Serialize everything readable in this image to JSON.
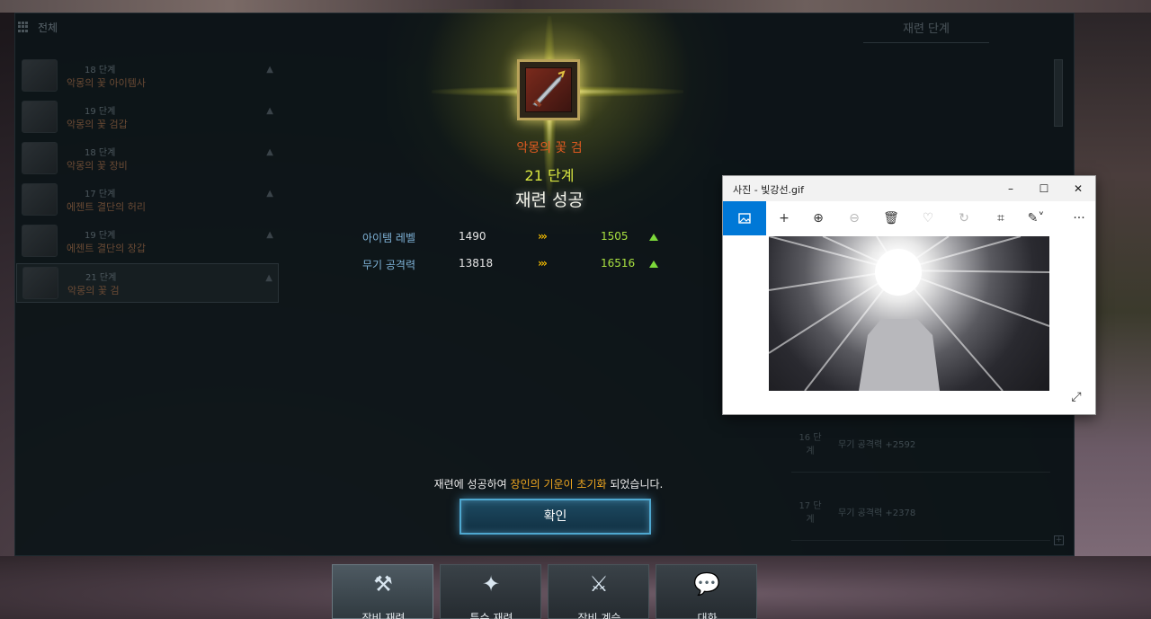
{
  "left_list": {
    "header": "전체",
    "items": [
      {
        "stage": "18 단계",
        "name": "악몽의 꽃 아이템사"
      },
      {
        "stage": "19 단계",
        "name": "악몽의 꽃 검갑"
      },
      {
        "stage": "18 단계",
        "name": "악몽의 꽃 장비"
      },
      {
        "stage": "17 단계",
        "name": "에젠트 결단의 허리"
      },
      {
        "stage": "19 단계",
        "name": "에젠트 결단의 장갑"
      },
      {
        "stage": "21 단계",
        "name": "악몽의 꽃 검"
      }
    ]
  },
  "right_panel": {
    "title": "재련 단계",
    "rows": [
      {
        "lvl": "16 단계",
        "text": "무기 공격력 +2592"
      },
      {
        "lvl": "17 단계",
        "text": "무기 공격력 +2378"
      }
    ]
  },
  "result": {
    "item_name": "악몽의 꽃 검",
    "stage": "21 단계",
    "outcome": "재련 성공",
    "stats": [
      {
        "label": "아이템 레벨",
        "before": "1490",
        "arrows": "›››",
        "after": "1505"
      },
      {
        "label": "무기 공격력",
        "before": "13818",
        "arrows": "›››",
        "after": "16516"
      }
    ],
    "message_pre": "재련에 성공하여 ",
    "message_highlight": "장인의 기운이 초기화",
    "message_post": " 되었습니다.",
    "confirm_label": "확인"
  },
  "bottom_tabs": [
    {
      "label": "장비 재련",
      "icon": "hammer-icon"
    },
    {
      "label": "특수 재련",
      "icon": "special-refine-icon"
    },
    {
      "label": "장비 계승",
      "icon": "swords-icon"
    },
    {
      "label": "대화",
      "icon": "chat-icon"
    }
  ],
  "photos_window": {
    "title": "사진 - 빛강선.gif",
    "minimize": "–",
    "maximize": "☐",
    "close": "✕",
    "toolbar": [
      "image-icon",
      "plus-icon",
      "zoom-in-icon",
      "zoom-out-icon",
      "delete-icon",
      "heart-icon",
      "rotate-icon",
      "crop-icon",
      "edit-icon",
      "more-icon"
    ],
    "more": "···"
  },
  "colors": {
    "accent_blue": "#0078d7",
    "stat_label": "#7fb3d8",
    "stat_up": "#a8e040",
    "highlight": "#f0a820",
    "item_name": "#e05a20",
    "stage": "#d9e640"
  }
}
